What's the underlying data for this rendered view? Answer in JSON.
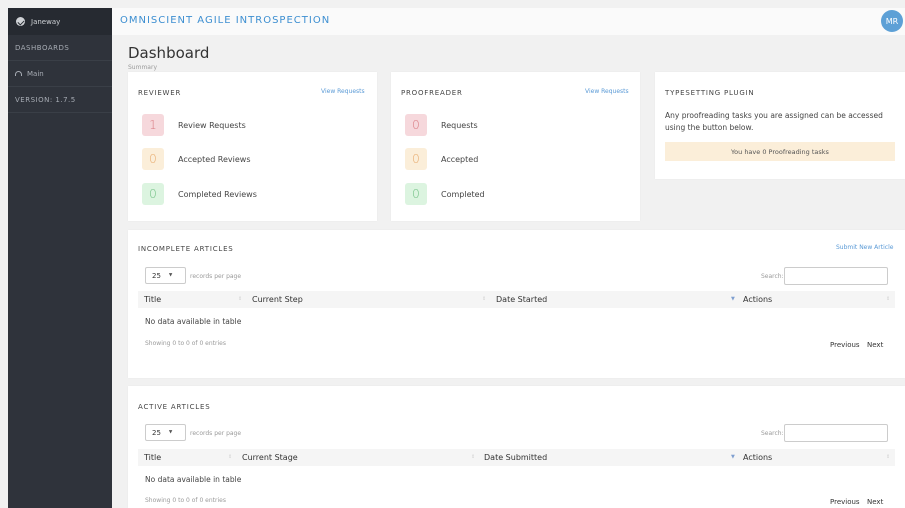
{
  "sidebar": {
    "brand": "Janeway",
    "section": "DASHBOARDS",
    "main_item": "Main",
    "version": "VERSION: 1.7.5"
  },
  "topbar": {
    "title": "OMNISCIENT AGILE INTROSPECTION",
    "avatar": "MR"
  },
  "page": {
    "title": "Dashboard",
    "subtitle": "Summary"
  },
  "reviewer": {
    "heading": "REVIEWER",
    "link": "View Requests",
    "stats": [
      {
        "value": "1",
        "label": "Review Requests"
      },
      {
        "value": "0",
        "label": "Accepted Reviews"
      },
      {
        "value": "0",
        "label": "Completed Reviews"
      }
    ]
  },
  "proofreader": {
    "heading": "PROOFREADER",
    "link": "View Requests",
    "stats": [
      {
        "value": "0",
        "label": "Requests"
      },
      {
        "value": "0",
        "label": "Accepted"
      },
      {
        "value": "0",
        "label": "Completed"
      }
    ]
  },
  "plugin": {
    "heading": "TYPESETTING PLUGIN",
    "text": "Any proofreading tasks you are assigned can be accessed using the button below.",
    "alert": "You have 0 Proofreading tasks"
  },
  "incomplete": {
    "heading": "INCOMPLETE ARTICLES",
    "link": "Submit New Article",
    "length_value": "25",
    "length_text": "records per page",
    "search_label": "Search:",
    "columns": [
      "Title",
      "Current Step",
      "Date Started",
      "Actions"
    ],
    "empty": "No data available in table",
    "info": "Showing 0 to 0 of 0 entries",
    "prev": "Previous",
    "next": "Next"
  },
  "active": {
    "heading": "ACTIVE ARTICLES",
    "length_value": "25",
    "length_text": "records per page",
    "search_label": "Search:",
    "columns": [
      "Title",
      "Current Stage",
      "Date Submitted",
      "Actions"
    ],
    "empty": "No data available in table",
    "info": "Showing 0 to 0 of 0 entries",
    "prev": "Previous",
    "next": "Next"
  }
}
